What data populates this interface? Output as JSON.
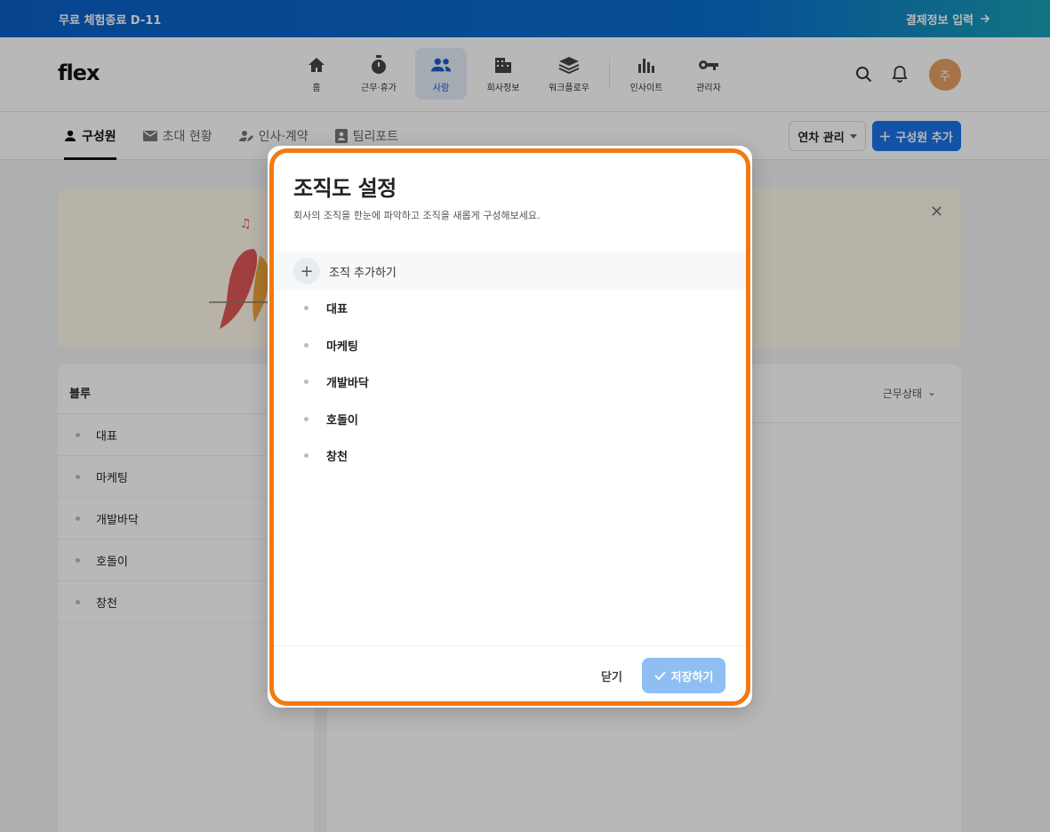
{
  "banner": {
    "trial": "무료 체험종료 D-11",
    "payment": "결제정보 입력"
  },
  "header": {
    "logo": "flex",
    "nav": [
      {
        "label": "홈",
        "icon": "home-icon"
      },
      {
        "label": "근무·휴가",
        "icon": "stopwatch-icon"
      },
      {
        "label": "사람",
        "icon": "people-icon",
        "active": true
      },
      {
        "label": "회사정보",
        "icon": "building-icon"
      },
      {
        "label": "워크플로우",
        "icon": "layers-icon"
      },
      {
        "label": "인사이트",
        "icon": "bar-chart-icon"
      },
      {
        "label": "관리자",
        "icon": "key-icon"
      }
    ],
    "avatar": "주"
  },
  "subbar": {
    "tabs": [
      "구성원",
      "초대 현황",
      "인사·계약",
      "팀리포트"
    ],
    "leave_button": "연차 관리",
    "add_member_button": "구성원 추가"
  },
  "left_panel": {
    "title": "블루",
    "items": [
      "대표",
      "마케팅",
      "개발바닥",
      "호돌이",
      "창천"
    ]
  },
  "right_panel": {
    "status_filter": "근무상태"
  },
  "modal": {
    "title": "조직도 설정",
    "subtitle": "회사의 조직을 한눈에 파악하고 조직을 새롭게 구성해보세요.",
    "add_org": "조직 추가하기",
    "orgs": [
      "대표",
      "마케팅",
      "개발바닥",
      "호돌이",
      "창천"
    ],
    "close": "닫기",
    "save": "저장하기"
  },
  "colors": {
    "brand": "#1a73e8",
    "highlight": "#f07a12",
    "save_disabled": "#8fbff2"
  }
}
